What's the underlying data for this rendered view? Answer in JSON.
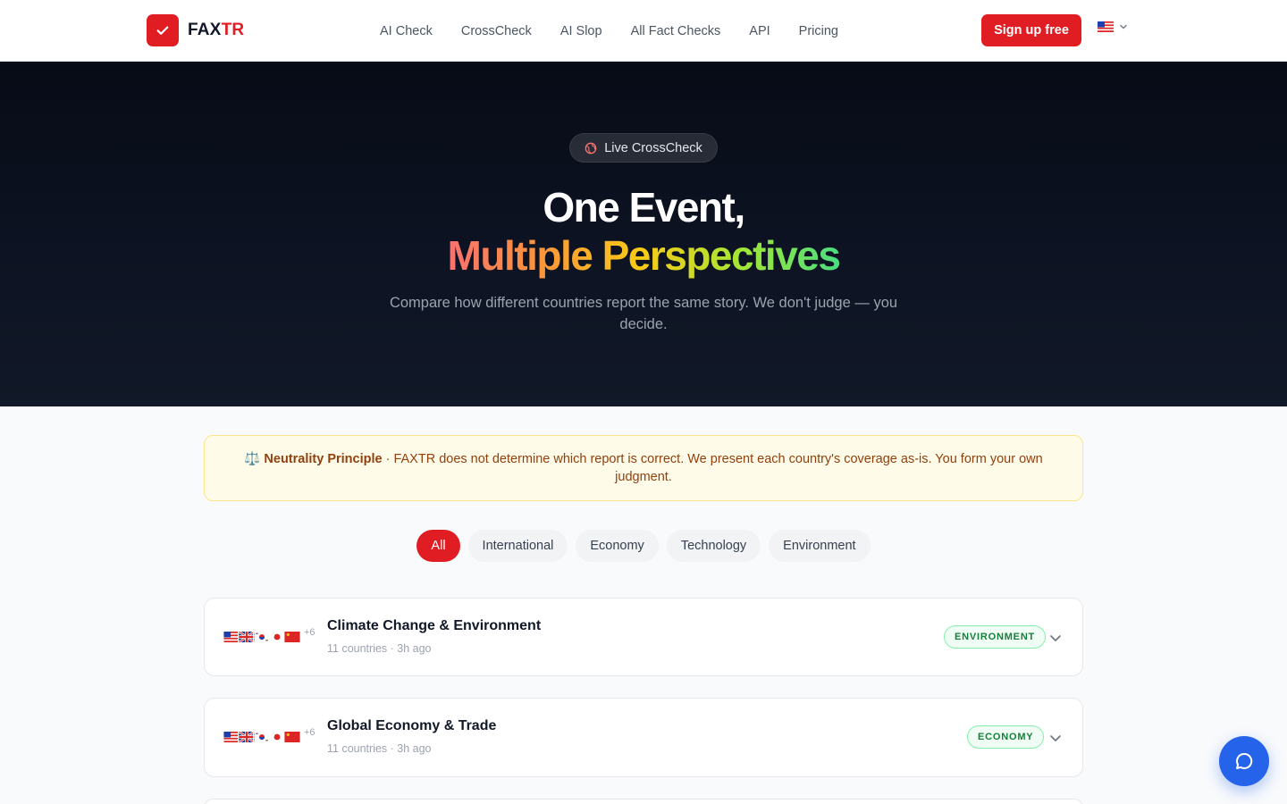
{
  "brand": {
    "name_prefix": "FAX",
    "name_suffix": "TR",
    "color": "#e11d24"
  },
  "nav": {
    "items": [
      {
        "label": "AI Check"
      },
      {
        "label": "CrossCheck"
      },
      {
        "label": "AI Slop"
      },
      {
        "label": "All Fact Checks"
      },
      {
        "label": "API"
      },
      {
        "label": "Pricing"
      }
    ],
    "signup_label": "Sign up free",
    "language_flag": "🇺🇸"
  },
  "hero": {
    "pill_label": "Live CrossCheck",
    "pill_icon": "globe-icon",
    "title_line1": "One Event,",
    "title_line2": "Multiple Perspectives",
    "subtitle": "Compare how different countries report the same story. We don't judge — you decide."
  },
  "notice": {
    "icon": "⚖️",
    "title": "Neutrality Principle",
    "text": " · FAXTR does not determine which report is correct. We present each country's coverage as-is. You form your own judgment."
  },
  "filters": [
    {
      "label": "All",
      "active": true
    },
    {
      "label": "International",
      "active": false
    },
    {
      "label": "Economy",
      "active": false
    },
    {
      "label": "Technology",
      "active": false
    },
    {
      "label": "Environment",
      "active": false
    }
  ],
  "events": [
    {
      "title": "Climate Change & Environment",
      "meta": "11 countries · 3h ago",
      "more_flags": "+6",
      "tag": "ENVIRONMENT",
      "flags": [
        "us",
        "gb",
        "kr",
        "jp",
        "cn"
      ]
    },
    {
      "title": "Global Economy & Trade",
      "meta": "11 countries · 3h ago",
      "more_flags": "+6",
      "tag": "ECONOMY",
      "flags": [
        "us",
        "gb",
        "kr",
        "jp",
        "cn"
      ]
    }
  ],
  "colors": {
    "accent": "#e11d24",
    "hero_bg": "#0b1120",
    "tag_green": "#15803d",
    "chat_blue": "#2563eb"
  }
}
